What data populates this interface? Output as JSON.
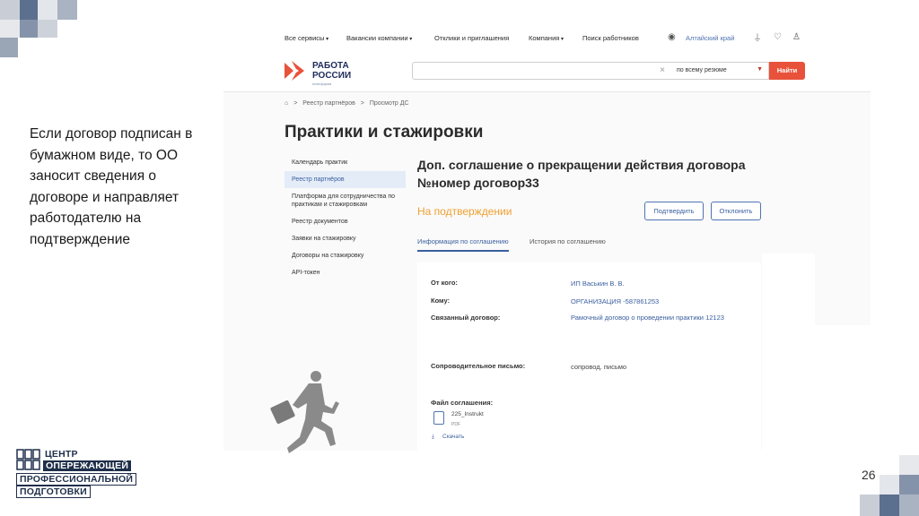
{
  "slide": {
    "text": "Если договор подписан в бумажном виде, то ОО заносит сведения о договоре и направляет работодателю на подтверждение",
    "page_number": "26",
    "brand_lines": [
      "ЦЕНТР",
      "ОПЕРЕЖАЮЩЕЙ",
      "ПРОФЕССИОНАЛЬНОЙ",
      "ПОДГОТОВКИ"
    ]
  },
  "topnav": {
    "all_services": "Все сервисы",
    "company_vacancies": "Вакансии компании",
    "responses": "Отклики и приглашения",
    "company": "Компания",
    "find_workers": "Поиск работников",
    "region": "Алтайский край"
  },
  "header": {
    "logo_line1": "РАБОТА",
    "logo_line2": "РОССИИ",
    "logo_sub": "платформа",
    "search_placeholder": "",
    "search_scope": "по всему резюме",
    "search_button": "Найти"
  },
  "breadcrumb": [
    "⌂",
    ">",
    "Реестр партнёров",
    ">",
    "Просмотр ДС"
  ],
  "page_title": "Практики и стажировки",
  "sidebar": {
    "items": [
      {
        "label": "Календарь практик"
      },
      {
        "label": "Реестр партнёров"
      },
      {
        "label": "Платформа для сотрудничества по практикам и стажировкам"
      },
      {
        "label": "Реестр документов"
      },
      {
        "label": "Заявки на стажировку"
      },
      {
        "label": "Договоры на стажировку"
      },
      {
        "label": "API-токен"
      }
    ]
  },
  "document": {
    "title": "Доп. соглашение о прекращении действия договора №номер договор33",
    "status": "На подтверждении",
    "confirm_button": "Подтвердить",
    "reject_button": "Отклонить",
    "tabs": [
      "Информация по соглашению",
      "История по соглашению"
    ],
    "from_label": "От кого:",
    "from_value": "ИП Васькин В. В.",
    "to_label": "Кому:",
    "to_value": "ОРГАНИЗАЦИЯ -587861253",
    "contract_label": "Связанный договор:",
    "contract_value": "Рамочный договор о проведении практики 12123",
    "letter_label": "Сопроводительное письмо:",
    "letter_value": "сопровод. письмо",
    "file_label": "Файл соглашения:",
    "file_name": "225_Instrukt",
    "file_type": "PDF",
    "download": "Скачать"
  },
  "colors": {
    "accent_blue": "#3a5f9f",
    "status_orange": "#f0a030",
    "search_button": "#e8523a",
    "brand_navy": "#1f2f4a"
  }
}
